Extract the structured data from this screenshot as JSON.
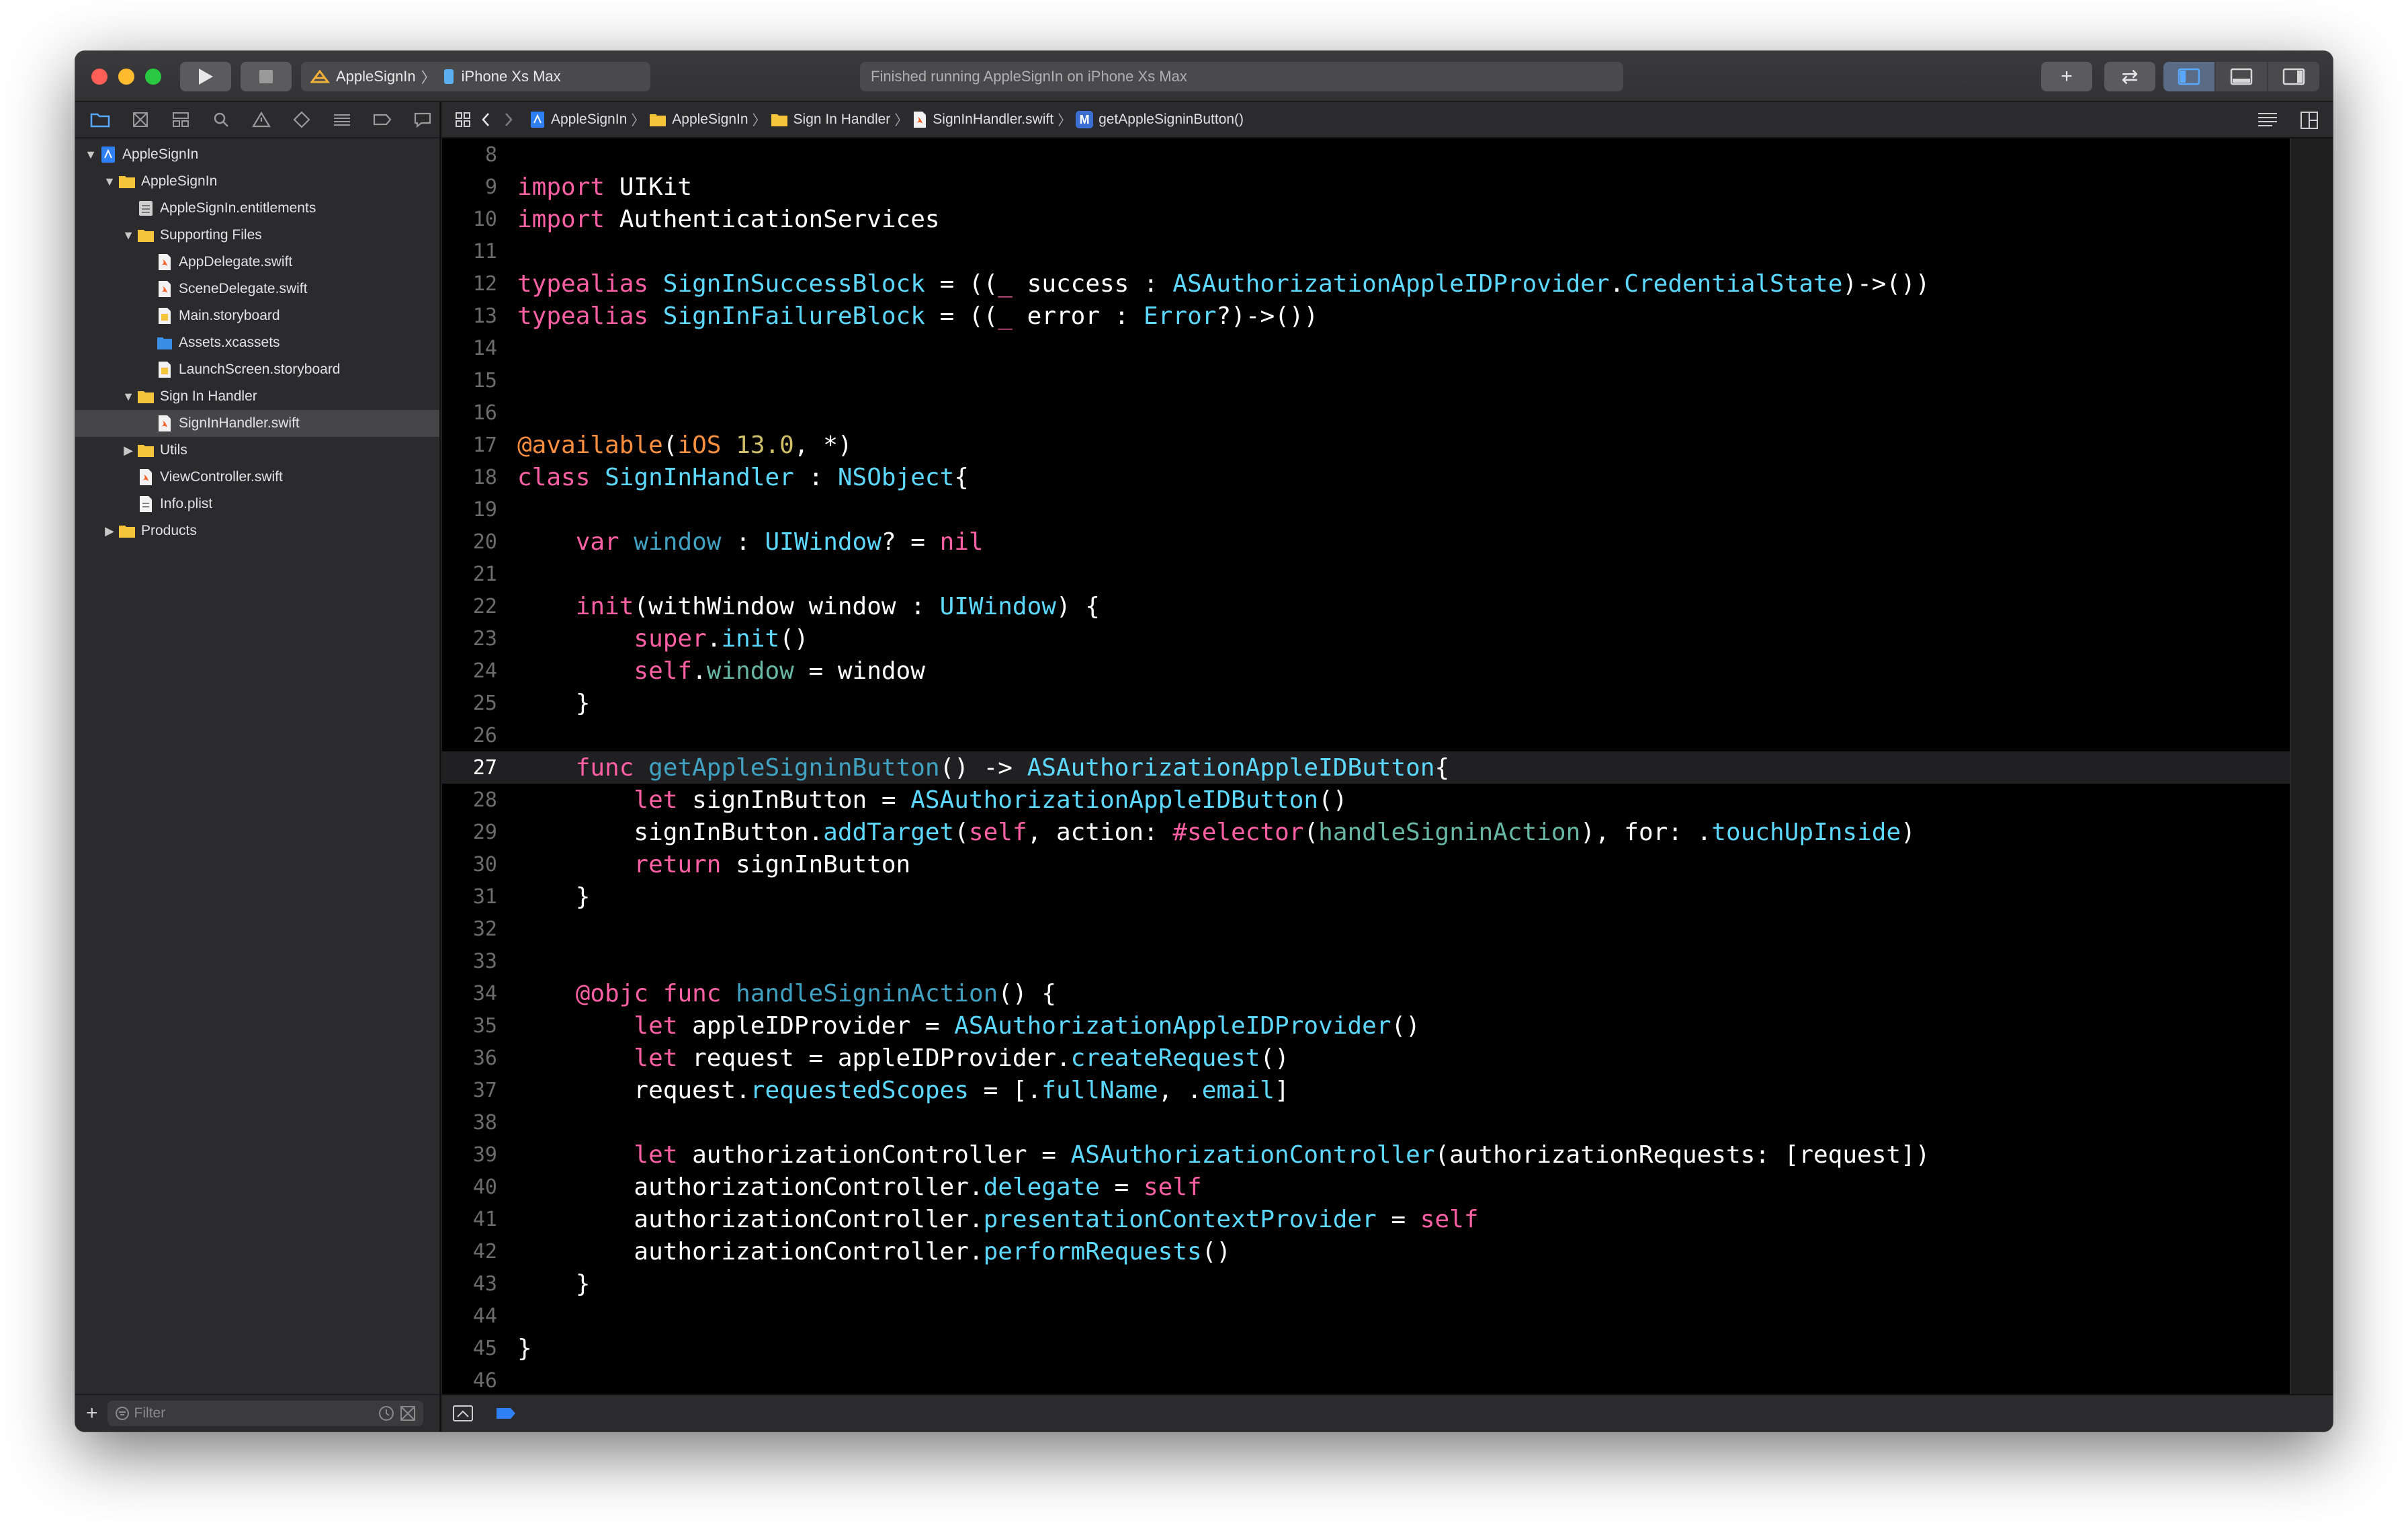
{
  "toolbar": {
    "scheme_name": "AppleSignIn",
    "scheme_sep": "〉",
    "device": "iPhone Xs Max",
    "status_text": "Finished running AppleSignIn on iPhone Xs Max",
    "add_label": "+",
    "swap_label": "⇄"
  },
  "navigator": {
    "tabs": [
      "folder-icon",
      "source-control-icon",
      "hierarchy-icon",
      "search-icon",
      "warning-icon",
      "test-icon",
      "debug-icon",
      "breakpoint-icon",
      "report-icon"
    ],
    "tree": [
      {
        "label": "AppleSignIn",
        "depth": 0,
        "kind": "project",
        "open": true
      },
      {
        "label": "AppleSignIn",
        "depth": 1,
        "kind": "folder",
        "open": true
      },
      {
        "label": "AppleSignIn.entitlements",
        "depth": 2,
        "kind": "entitlements"
      },
      {
        "label": "Supporting Files",
        "depth": 2,
        "kind": "folder",
        "open": true
      },
      {
        "label": "AppDelegate.swift",
        "depth": 3,
        "kind": "swift"
      },
      {
        "label": "SceneDelegate.swift",
        "depth": 3,
        "kind": "swift"
      },
      {
        "label": "Main.storyboard",
        "depth": 3,
        "kind": "storyboard"
      },
      {
        "label": "Assets.xcassets",
        "depth": 3,
        "kind": "assets"
      },
      {
        "label": "LaunchScreen.storyboard",
        "depth": 3,
        "kind": "storyboard"
      },
      {
        "label": "Sign In Handler",
        "depth": 2,
        "kind": "folder",
        "open": true
      },
      {
        "label": "SignInHandler.swift",
        "depth": 3,
        "kind": "swift",
        "selected": true
      },
      {
        "label": "Utils",
        "depth": 2,
        "kind": "folder",
        "open": false
      },
      {
        "label": "ViewController.swift",
        "depth": 2,
        "kind": "swift"
      },
      {
        "label": "Info.plist",
        "depth": 2,
        "kind": "plist"
      },
      {
        "label": "Products",
        "depth": 1,
        "kind": "folder",
        "open": false
      }
    ],
    "filter_placeholder": "Filter",
    "add_label": "+"
  },
  "jumpbar": {
    "crumbs": [
      "AppleSignIn",
      "AppleSignIn",
      "Sign In Handler",
      "SignInHandler.swift",
      "getAppleSigninButton()"
    ],
    "chevron": "〉",
    "method_badge": "M"
  },
  "editor": {
    "current_line": 27,
    "lines": [
      {
        "n": 8,
        "tokens": []
      },
      {
        "n": 9,
        "tokens": [
          [
            "kw",
            "import"
          ],
          [
            "plain",
            " UIKit"
          ]
        ]
      },
      {
        "n": 10,
        "tokens": [
          [
            "kw",
            "import"
          ],
          [
            "plain",
            " AuthenticationServices"
          ]
        ]
      },
      {
        "n": 11,
        "tokens": []
      },
      {
        "n": 12,
        "tokens": [
          [
            "kw",
            "typealias"
          ],
          [
            "plain",
            " "
          ],
          [
            "decl2",
            "SignInSuccessBlock"
          ],
          [
            "plain",
            " = (("
          ],
          [
            "kw",
            "_"
          ],
          [
            "plain",
            " success : "
          ],
          [
            "ty",
            "ASAuthorizationAppleIDProvider"
          ],
          [
            "plain",
            "."
          ],
          [
            "ty",
            "CredentialState"
          ],
          [
            "plain",
            ")->())"
          ]
        ]
      },
      {
        "n": 13,
        "tokens": [
          [
            "kw",
            "typealias"
          ],
          [
            "plain",
            " "
          ],
          [
            "decl2",
            "SignInFailureBlock"
          ],
          [
            "plain",
            " = (("
          ],
          [
            "kw",
            "_"
          ],
          [
            "plain",
            " error : "
          ],
          [
            "ty",
            "Error"
          ],
          [
            "plain",
            "?)->())"
          ]
        ]
      },
      {
        "n": 14,
        "tokens": []
      },
      {
        "n": 15,
        "tokens": []
      },
      {
        "n": 16,
        "tokens": []
      },
      {
        "n": 17,
        "tokens": [
          [
            "attr",
            "@available"
          ],
          [
            "plain",
            "("
          ],
          [
            "attr",
            "iOS"
          ],
          [
            "plain",
            " "
          ],
          [
            "num",
            "13.0"
          ],
          [
            "plain",
            ", *)"
          ]
        ]
      },
      {
        "n": 18,
        "tokens": [
          [
            "kw",
            "class"
          ],
          [
            "plain",
            " "
          ],
          [
            "decl2",
            "SignInHandler"
          ],
          [
            "plain",
            " : "
          ],
          [
            "ty",
            "NSObject"
          ],
          [
            "plain",
            "{"
          ]
        ]
      },
      {
        "n": 19,
        "tokens": []
      },
      {
        "n": 20,
        "tokens": [
          [
            "plain",
            "    "
          ],
          [
            "kw",
            "var"
          ],
          [
            "plain",
            " "
          ],
          [
            "decl",
            "window"
          ],
          [
            "plain",
            " : "
          ],
          [
            "ty",
            "UIWindow"
          ],
          [
            "plain",
            "? = "
          ],
          [
            "kw",
            "nil"
          ]
        ]
      },
      {
        "n": 21,
        "tokens": []
      },
      {
        "n": 22,
        "tokens": [
          [
            "plain",
            "    "
          ],
          [
            "kw",
            "init"
          ],
          [
            "plain",
            "(withWindow window : "
          ],
          [
            "ty",
            "UIWindow"
          ],
          [
            "plain",
            ") {"
          ]
        ]
      },
      {
        "n": 23,
        "tokens": [
          [
            "plain",
            "        "
          ],
          [
            "kw",
            "super"
          ],
          [
            "plain",
            "."
          ],
          [
            "meth",
            "init"
          ],
          [
            "plain",
            "()"
          ]
        ]
      },
      {
        "n": 24,
        "tokens": [
          [
            "plain",
            "        "
          ],
          [
            "kw",
            "self"
          ],
          [
            "plain",
            "."
          ],
          [
            "prop",
            "window"
          ],
          [
            "plain",
            " = window"
          ]
        ]
      },
      {
        "n": 25,
        "tokens": [
          [
            "plain",
            "    }"
          ]
        ]
      },
      {
        "n": 26,
        "tokens": []
      },
      {
        "n": 27,
        "tokens": [
          [
            "plain",
            "    "
          ],
          [
            "kw",
            "func"
          ],
          [
            "plain",
            " "
          ],
          [
            "decl",
            "getAppleSigninButton"
          ],
          [
            "plain",
            "() -> "
          ],
          [
            "ty",
            "ASAuthorizationAppleIDButton"
          ],
          [
            "plain",
            "{"
          ]
        ]
      },
      {
        "n": 28,
        "tokens": [
          [
            "plain",
            "        "
          ],
          [
            "kw",
            "let"
          ],
          [
            "plain",
            " signInButton = "
          ],
          [
            "ty",
            "ASAuthorizationAppleIDButton"
          ],
          [
            "plain",
            "()"
          ]
        ]
      },
      {
        "n": 29,
        "tokens": [
          [
            "plain",
            "        signInButton."
          ],
          [
            "meth",
            "addTarget"
          ],
          [
            "plain",
            "("
          ],
          [
            "kw",
            "self"
          ],
          [
            "plain",
            ", action: "
          ],
          [
            "kw",
            "#selector"
          ],
          [
            "plain",
            "("
          ],
          [
            "prop",
            "handleSigninAction"
          ],
          [
            "plain",
            "), for: ."
          ],
          [
            "meth",
            "touchUpInside"
          ],
          [
            "plain",
            ")"
          ]
        ]
      },
      {
        "n": 30,
        "tokens": [
          [
            "plain",
            "        "
          ],
          [
            "kw",
            "return"
          ],
          [
            "plain",
            " signInButton"
          ]
        ]
      },
      {
        "n": 31,
        "tokens": [
          [
            "plain",
            "    }"
          ]
        ]
      },
      {
        "n": 32,
        "tokens": []
      },
      {
        "n": 33,
        "tokens": []
      },
      {
        "n": 34,
        "tokens": [
          [
            "plain",
            "    "
          ],
          [
            "kw",
            "@objc"
          ],
          [
            "plain",
            " "
          ],
          [
            "kw",
            "func"
          ],
          [
            "plain",
            " "
          ],
          [
            "decl",
            "handleSigninAction"
          ],
          [
            "plain",
            "() {"
          ]
        ]
      },
      {
        "n": 35,
        "tokens": [
          [
            "plain",
            "        "
          ],
          [
            "kw",
            "let"
          ],
          [
            "plain",
            " appleIDProvider = "
          ],
          [
            "ty",
            "ASAuthorizationAppleIDProvider"
          ],
          [
            "plain",
            "()"
          ]
        ]
      },
      {
        "n": 36,
        "tokens": [
          [
            "plain",
            "        "
          ],
          [
            "kw",
            "let"
          ],
          [
            "plain",
            " request = appleIDProvider."
          ],
          [
            "meth",
            "createRequest"
          ],
          [
            "plain",
            "()"
          ]
        ]
      },
      {
        "n": 37,
        "tokens": [
          [
            "plain",
            "        request."
          ],
          [
            "meth",
            "requestedScopes"
          ],
          [
            "plain",
            " = [."
          ],
          [
            "meth",
            "fullName"
          ],
          [
            "plain",
            ", ."
          ],
          [
            "meth",
            "email"
          ],
          [
            "plain",
            "]"
          ]
        ]
      },
      {
        "n": 38,
        "tokens": []
      },
      {
        "n": 39,
        "tokens": [
          [
            "plain",
            "        "
          ],
          [
            "kw",
            "let"
          ],
          [
            "plain",
            " authorizationController = "
          ],
          [
            "ty",
            "ASAuthorizationController"
          ],
          [
            "plain",
            "(authorizationRequests: [request])"
          ]
        ]
      },
      {
        "n": 40,
        "tokens": [
          [
            "plain",
            "        authorizationController."
          ],
          [
            "meth",
            "delegate"
          ],
          [
            "plain",
            " = "
          ],
          [
            "kw",
            "self"
          ]
        ]
      },
      {
        "n": 41,
        "tokens": [
          [
            "plain",
            "        authorizationController."
          ],
          [
            "meth",
            "presentationContextProvider"
          ],
          [
            "plain",
            " = "
          ],
          [
            "kw",
            "self"
          ]
        ]
      },
      {
        "n": 42,
        "tokens": [
          [
            "plain",
            "        authorizationController."
          ],
          [
            "meth",
            "performRequests"
          ],
          [
            "plain",
            "()"
          ]
        ]
      },
      {
        "n": 43,
        "tokens": [
          [
            "plain",
            "    }"
          ]
        ]
      },
      {
        "n": 44,
        "tokens": []
      },
      {
        "n": 45,
        "tokens": [
          [
            "plain",
            "}"
          ]
        ]
      },
      {
        "n": 46,
        "tokens": []
      }
    ]
  },
  "colors": {
    "keyword": "#fc5fa3",
    "type": "#5dd8ff",
    "declaration": "#41a1c0",
    "project_declaration": "#5dd8ff",
    "attribute": "#fd8f3f",
    "number": "#d0bf69",
    "method": "#5dd8ff",
    "property": "#67b7a4",
    "folder": "#f4c43a",
    "swift": "#f2632b",
    "selection": "#464649"
  }
}
